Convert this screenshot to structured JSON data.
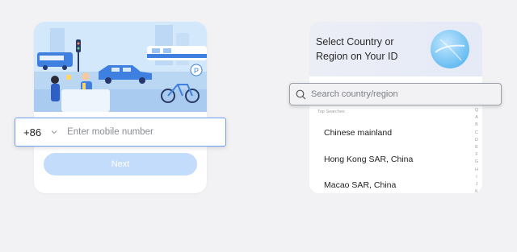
{
  "phone_login": {
    "country_code": "+86",
    "phone_placeholder": "Enter mobile number",
    "next_label": "Next"
  },
  "region_picker": {
    "title": "Select Country or Region on Your ID",
    "search_placeholder": "Search country/region",
    "top_searches_label": "Top Searches",
    "items": [
      {
        "label": "Chinese mainland"
      },
      {
        "label": "Hong Kong SAR, China"
      },
      {
        "label": "Macao SAR, China"
      }
    ],
    "alpha_index": [
      "Q",
      "A",
      "B",
      "C",
      "D",
      "E",
      "F",
      "G",
      "H",
      "I",
      "J",
      "K"
    ]
  },
  "colors": {
    "accent": "#6d9ff2",
    "button_disabled": "#c4dcfb",
    "illustration_bg": "#c7e1f8"
  }
}
